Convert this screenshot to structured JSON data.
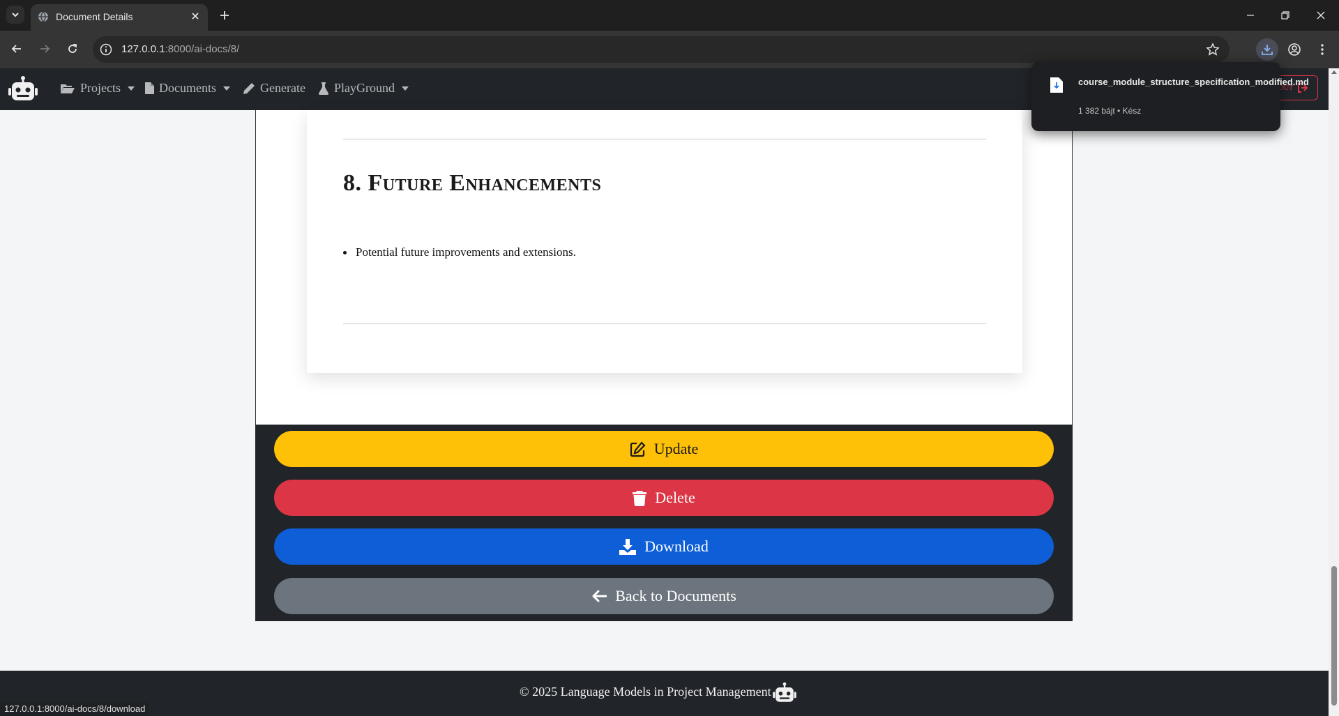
{
  "browser": {
    "tab_title": "Document Details",
    "url_host": "127.0.0.1",
    "url_rest": ":8000/ai-docs/8/",
    "status_url": "127.0.0.1:8000/ai-docs/8/download"
  },
  "download": {
    "filename": "course_module_structure_specification_modified.md",
    "meta": "1 382 bájt • Kész"
  },
  "nav": {
    "items": [
      {
        "label": "Projects",
        "icon": "folder-open-icon"
      },
      {
        "label": "Documents",
        "icon": "file-icon"
      },
      {
        "label": "Generate",
        "icon": "pencil-icon"
      },
      {
        "label": "PlayGround",
        "icon": "flask-icon"
      }
    ],
    "logout_label": "out"
  },
  "document": {
    "section_title": "8. Future Enhancements",
    "bullet": "Potential future improvements and extensions."
  },
  "actions": {
    "update": "Update",
    "delete": "Delete",
    "download": "Download",
    "back": "Back to Documents"
  },
  "colors": {
    "update": "#ffc107",
    "delete": "#dc3545",
    "download": "#0d5ed7",
    "back": "#6c757d",
    "navbar": "#212529"
  },
  "footer": {
    "text": "© 2025 Language Models in Project Management"
  }
}
